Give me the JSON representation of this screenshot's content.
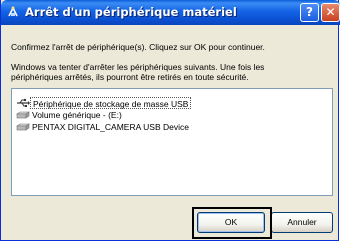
{
  "window": {
    "title": "Arrêt d'un périphérique matériel",
    "help_glyph": "?",
    "close_glyph": "✕"
  },
  "body": {
    "line1": "Confirmez l'arrêt de périphérique(s). Cliquez sur OK pour continuer.",
    "line2": "Windows va tenter d'arrêter les périphériques suivants. Une fois les",
    "line3": "périphériques arrêtés, ils pourront être retirés en toute sécurité."
  },
  "devices": [
    {
      "label": "Périphérique de stockage de masse USB",
      "icon": "usb-icon",
      "selected": true
    },
    {
      "label": "Volume générique - (E:)",
      "icon": "drive-icon",
      "selected": false
    },
    {
      "label": "PENTAX DIGITAL_CAMERA USB Device",
      "icon": "drive-icon",
      "selected": false
    }
  ],
  "buttons": {
    "ok_label": "OK",
    "cancel_label": "Annuler"
  }
}
